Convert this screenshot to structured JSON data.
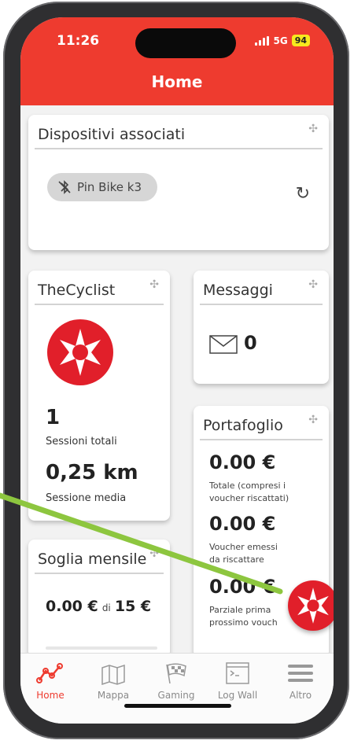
{
  "status_bar": {
    "time": "11:26",
    "network": "5G",
    "battery": "94"
  },
  "header": {
    "title": "Home"
  },
  "devices_card": {
    "title": "Dispositivi associati",
    "device_chip": "Pin Bike k3"
  },
  "cyclist_card": {
    "title": "TheCyclist",
    "sessions_value": "1",
    "sessions_label": "Sessioni totali",
    "avg_value": "0,25 km",
    "avg_label": "Sessione media"
  },
  "messages_card": {
    "title": "Messaggi",
    "count": "0"
  },
  "wallet_card": {
    "title": "Portafoglio",
    "total_value": "0.00 €",
    "total_label_1": "Totale (compresi i",
    "total_label_2": "voucher riscattati)",
    "voucher_value": "0.00 €",
    "voucher_label_1": "Voucher emessi",
    "voucher_label_2": "da riscattare",
    "partial_value": "0.00 €",
    "partial_label_1": "Parziale prima",
    "partial_label_2": "prossimo vouch"
  },
  "threshold_card": {
    "title": "Soglia mensile",
    "current": "0.00 €",
    "of": "di",
    "limit": "15 €"
  },
  "tabs": [
    {
      "label": "Home",
      "active": true
    },
    {
      "label": "Mappa",
      "active": false
    },
    {
      "label": "Gaming",
      "active": false
    },
    {
      "label": "Log Wall",
      "active": false
    },
    {
      "label": "Altro",
      "active": false
    }
  ],
  "colors": {
    "brand_red": "#ee3b2f",
    "logo_red": "#e11f2a",
    "annotation_green": "#8dc63f"
  }
}
